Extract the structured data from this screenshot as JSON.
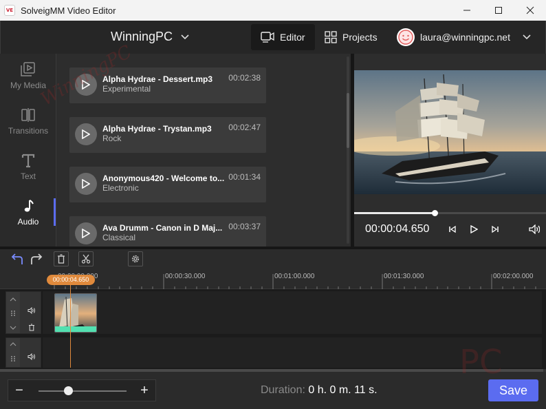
{
  "window": {
    "title": "SolveigMM Video Editor",
    "icon_text": "VE"
  },
  "header": {
    "project_name": "WinningPC",
    "tabs": [
      {
        "label": "Editor"
      },
      {
        "label": "Projects"
      }
    ],
    "user_email": "laura@winningpc.net"
  },
  "leftnav": {
    "items": [
      {
        "label": "My Media",
        "icon": "media-icon"
      },
      {
        "label": "Transitions",
        "icon": "transitions-icon"
      },
      {
        "label": "Text",
        "icon": "text-icon"
      },
      {
        "label": "Audio",
        "icon": "music-note-icon"
      }
    ],
    "active": "Audio"
  },
  "media_list": [
    {
      "title": "Alpha Hydrae - Dessert.mp3",
      "genre": "Experimental",
      "duration": "00:02:38"
    },
    {
      "title": "Alpha Hydrae - Trystan.mp3",
      "genre": "Rock",
      "duration": "00:02:47"
    },
    {
      "title": "Anonymous420 - Welcome to...",
      "genre": "Electronic",
      "duration": "00:01:34"
    },
    {
      "title": "Ava Drumm - Canon in D Maj...",
      "genre": "Classical",
      "duration": "00:03:37"
    }
  ],
  "preview": {
    "timecode": "00:00:04.650",
    "seek_fraction": 0.42
  },
  "timeline": {
    "playhead_label": "00:00:04.650",
    "ruler_labels": [
      "00:00:00.000",
      "00:00:30.000",
      "00:01:00.000",
      "00:01:30.000",
      "00:02:00.000"
    ]
  },
  "footer": {
    "duration_label": "Duration:",
    "duration_value": "0 h. 0 m. 11 s.",
    "save_label": "Save",
    "zoom_minus": "−",
    "zoom_plus": "+"
  },
  "watermark": {
    "text_left": "WinningPC",
    "text_right": "PC"
  },
  "colors": {
    "accent": "#5b6cf0",
    "playhead": "#e08a3c",
    "clip_audio_bar": "#52e0b0"
  }
}
